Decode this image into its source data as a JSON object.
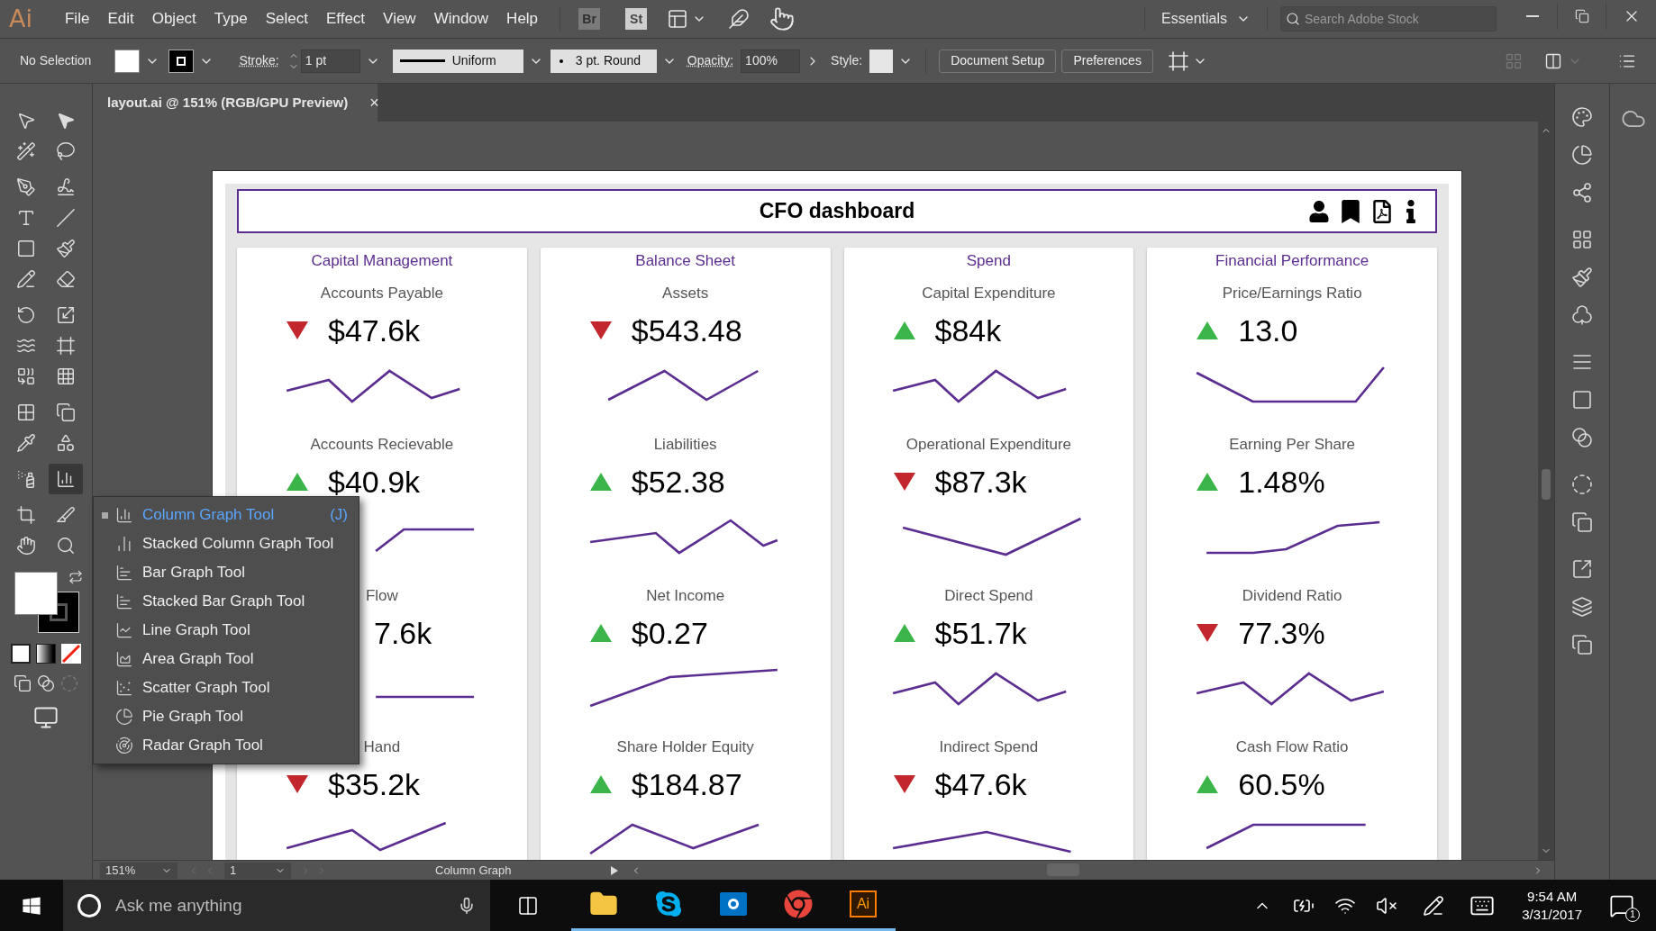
{
  "menu_bar": {
    "logo": "Ai",
    "menus": [
      "File",
      "Edit",
      "Object",
      "Type",
      "Select",
      "Effect",
      "View",
      "Window",
      "Help"
    ],
    "bridge": "Br",
    "stock": "St",
    "workspace": "Essentials",
    "search": {
      "placeholder": "Search Adobe Stock"
    }
  },
  "control_bar": {
    "selection": "No Selection",
    "stroke_label": "Stroke:",
    "stroke_weight": "1 pt",
    "profile": "Uniform",
    "brush": "3 pt. Round",
    "opacity_label": "Opacity:",
    "opacity": "100%",
    "style_label": "Style:",
    "buttons": [
      "Document Setup",
      "Preferences"
    ]
  },
  "document_tab": {
    "title": "layout.ai @ 151% (RGB/GPU Preview)",
    "close": "×"
  },
  "tool_flyout": [
    {
      "label": "Column Graph Tool",
      "shortcut": "(J)",
      "selected": true
    },
    {
      "label": "Stacked Column Graph Tool",
      "selected": false
    },
    {
      "label": "Bar Graph Tool",
      "selected": false
    },
    {
      "label": "Stacked Bar Graph Tool",
      "selected": false
    },
    {
      "label": "Line Graph Tool",
      "selected": false
    },
    {
      "label": "Area Graph Tool",
      "selected": false
    },
    {
      "label": "Scatter Graph Tool",
      "selected": false
    },
    {
      "label": "Pie Graph Tool",
      "selected": false
    },
    {
      "label": "Radar Graph Tool",
      "selected": false
    }
  ],
  "dashboard": {
    "title": "CFO dashboard",
    "cards": [
      {
        "title": "Capital Management",
        "metrics": [
          {
            "label": "Accounts Payable",
            "value": "$47.6k",
            "up": false
          },
          {
            "label": "Accounts Recievable",
            "value": "$40.9k",
            "up": true
          },
          {
            "label": "Flow",
            "value": "7.6k"
          },
          {
            "label": "Hand",
            "value": "$35.2k",
            "up": false
          }
        ]
      },
      {
        "title": "Balance Sheet",
        "metrics": [
          {
            "label": "Assets",
            "value": "$543.48",
            "up": false
          },
          {
            "label": "Liabilities",
            "value": "$52.38",
            "up": true
          },
          {
            "label": "Net Income",
            "value": "$0.27",
            "up": true
          },
          {
            "label": "Share Holder Equity",
            "value": "$184.87",
            "up": true
          }
        ]
      },
      {
        "title": "Spend",
        "metrics": [
          {
            "label": "Capital Expenditure",
            "value": "$84k",
            "up": true
          },
          {
            "label": "Operational Expenditure",
            "value": "$87.3k",
            "up": false
          },
          {
            "label": "Direct Spend",
            "value": "$51.7k",
            "up": true
          },
          {
            "label": "Indirect Spend",
            "value": "$47.6k",
            "up": false
          }
        ]
      },
      {
        "title": "Financial Performance",
        "metrics": [
          {
            "label": "Price/Earnings Ratio",
            "value": "13.0",
            "up": true
          },
          {
            "label": "Earning Per Share",
            "value": "1.48%",
            "up": true
          },
          {
            "label": "Dividend Ratio",
            "value": "77.3%",
            "up": false
          },
          {
            "label": "Cash Flow Ratio",
            "value": "60.5%",
            "up": true
          }
        ]
      }
    ]
  },
  "status_bar": {
    "zoom": "151%",
    "artboard": "1",
    "tool": "Column Graph"
  },
  "taskbar": {
    "search": {
      "placeholder": "Ask me anything"
    },
    "app_label": "Ai",
    "time": "9:54 AM",
    "date": "3/31/2017",
    "notifications": "1"
  }
}
